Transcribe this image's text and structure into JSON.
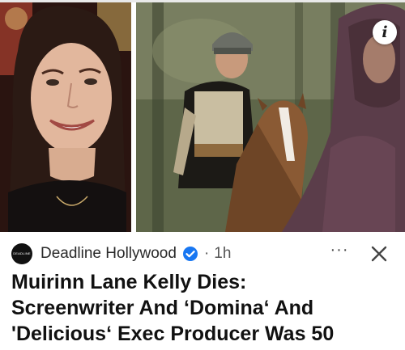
{
  "article": {
    "source": {
      "name": "Deadline Hollywood",
      "avatar_text": "DEADLINE",
      "verified": true,
      "time_ago": "1h",
      "separator": "·"
    },
    "headline_lines": [
      "Muirinn Lane Kelly Dies:",
      "Screenwriter And ‘Domina‘ And",
      "'Delicious‘ Exec Producer Was 50"
    ],
    "controls": {
      "info_icon": "i",
      "more_icon": "···",
      "close_icon": "close-icon"
    }
  },
  "colors": {
    "verified_blue": "#1877f2",
    "text_primary": "#111111",
    "text_secondary": "#555555"
  }
}
